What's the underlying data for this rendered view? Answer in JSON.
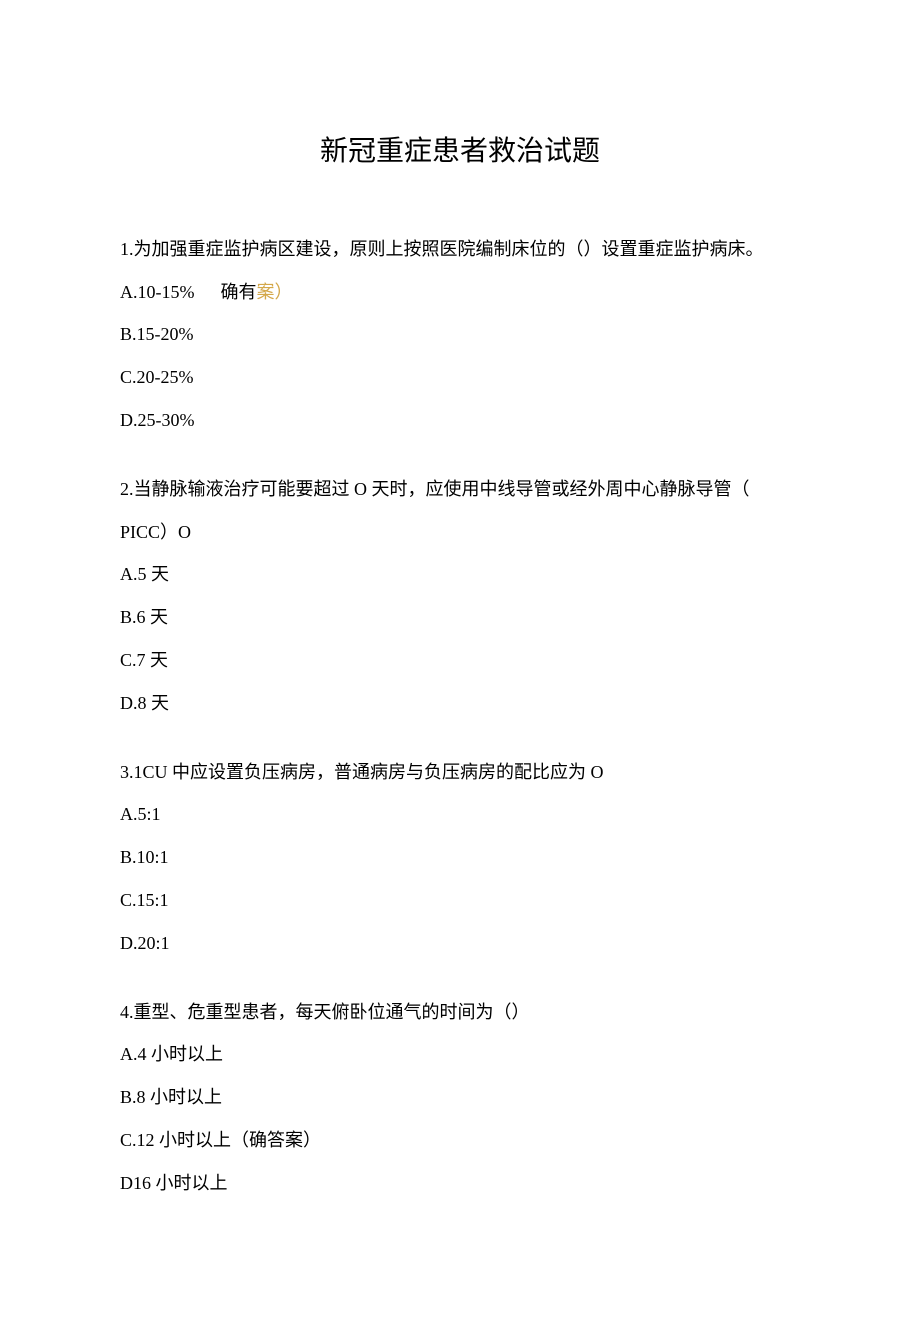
{
  "title": "新冠重症患者救治试题",
  "questions": [
    {
      "text": "1.为加强重症监护病区建设，原则上按照医院编制床位的（）设置重症监护病床。",
      "options": [
        {
          "label": "A.10-15%",
          "marker_prefix": "确有",
          "marker_suffix": "案）",
          "has_inline_marker": true
        },
        {
          "label": "B.15-20%"
        },
        {
          "label": "C.20-25%"
        },
        {
          "label": "D.25-30%"
        }
      ]
    },
    {
      "text_line1": "2.当静脉输液治疗可能要超过 O 天时，应使用中线导管或经外周中心静脉导管（",
      "text_line2": "PICC）O",
      "options": [
        {
          "label": "A.5 天"
        },
        {
          "label": "B.6 天"
        },
        {
          "label": "C.7 天"
        },
        {
          "label": "D.8 天"
        }
      ]
    },
    {
      "text": "3.1CU 中应设置负压病房，普通病房与负压病房的配比应为 O",
      "options": [
        {
          "label": "A.5:1"
        },
        {
          "label": "B.10:1"
        },
        {
          "label": "C.15:1"
        },
        {
          "label": "D.20:1"
        }
      ]
    },
    {
      "text": "4.重型、危重型患者，每天俯卧位通气的时间为（）",
      "options": [
        {
          "label": "A.4 小时以上"
        },
        {
          "label": "B.8 小时以上"
        },
        {
          "label": "C.12 小时以上（确答案）"
        },
        {
          "label": "D16 小时以上"
        }
      ]
    }
  ]
}
